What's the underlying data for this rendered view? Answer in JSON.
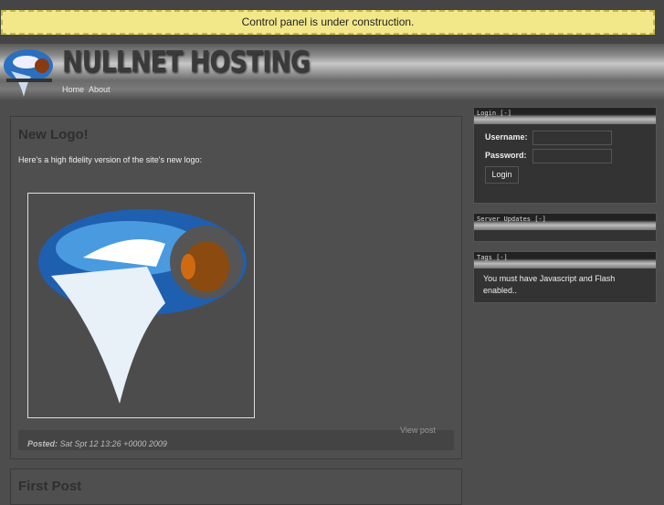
{
  "notice": "Control panel is under construction.",
  "header": {
    "brand": "NULLNET HOSTING",
    "nav": [
      "Home",
      "About"
    ]
  },
  "posts": [
    {
      "title": "New Logo!",
      "body": "Here's a high fidelity version of the site's new logo:",
      "posted_label": "Posted:",
      "posted_date": "Sat Spt 12 13:26 +0000 2009",
      "view_post": "View post"
    },
    {
      "title": "First Post"
    }
  ],
  "sidebar": {
    "login": {
      "title": "Login [-]",
      "username_label": "Username:",
      "password_label": "Password:",
      "username_value": "",
      "password_value": "",
      "button": "Login"
    },
    "updates": {
      "title": "Server Updates [-]"
    },
    "tags": {
      "title": "Tags [-]",
      "message": "You must have Javascript and Flash enabled.."
    }
  }
}
